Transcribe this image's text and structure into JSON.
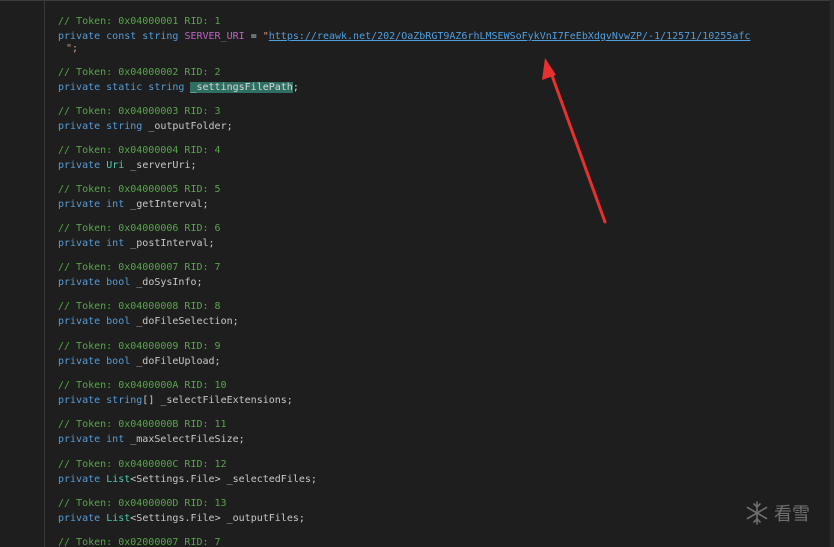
{
  "code": {
    "lines": [
      {
        "comment": "// Token: 0x04000001 RID: 1",
        "mods": "private const string",
        "name": "SERVER_URI",
        "eq": " = ",
        "q1": "\"",
        "url": "https://reawk.net/202/OaZbRGT9AZ6rhLMSEWSoFykVnI7FeEbXdgvNvwZP/-1/12571/10255afc",
        "q2": "\";"
      },
      {
        "comment": "// Token: 0x04000002 RID: 2",
        "mods": "private static string",
        "name": "_settingsFilePath",
        "end": ";"
      },
      {
        "comment": "// Token: 0x04000003 RID: 3",
        "mods": "private string",
        "name": "_outputFolder;"
      },
      {
        "comment": "// Token: 0x04000004 RID: 4",
        "mods": "private",
        "type": "Uri",
        "name": "_serverUri;"
      },
      {
        "comment": "// Token: 0x04000005 RID: 5",
        "mods": "private int",
        "name": "_getInterval;"
      },
      {
        "comment": "// Token: 0x04000006 RID: 6",
        "mods": "private int",
        "name": "_postInterval;"
      },
      {
        "comment": "// Token: 0x04000007 RID: 7",
        "mods": "private bool",
        "name": "_doSysInfo;"
      },
      {
        "comment": "// Token: 0x04000008 RID: 8",
        "mods": "private bool",
        "name": "_doFileSelection;"
      },
      {
        "comment": "// Token: 0x04000009 RID: 9",
        "mods": "private bool",
        "name": "_doFileUpload;"
      },
      {
        "comment": "// Token: 0x0400000A RID: 10",
        "mods": "private string",
        "brackets": "[]",
        "name": "_selectFileExtensions;"
      },
      {
        "comment": "// Token: 0x0400000B RID: 11",
        "mods": "private int",
        "name": "_maxSelectFileSize;"
      },
      {
        "comment": "// Token: 0x0400000C RID: 12",
        "mods": "private",
        "type": "List",
        "generic": "<Settings.File>",
        "name": "_selectedFiles;"
      },
      {
        "comment": "// Token: 0x0400000D RID: 13",
        "mods": "private",
        "type": "List",
        "generic": "<Settings.File>",
        "name": "_outputFiles;"
      },
      {
        "comment": "// Token: 0x02000007 RID: 7"
      }
    ]
  },
  "watermark": {
    "text": "看雪",
    "icon": "snowflake-icon"
  },
  "colors": {
    "background": "#1e1e1e",
    "comment": "#57a64a",
    "keyword": "#569cd6",
    "type": "#4ec9b0",
    "link": "#4f9ee0",
    "arrow": "#e8302f"
  }
}
